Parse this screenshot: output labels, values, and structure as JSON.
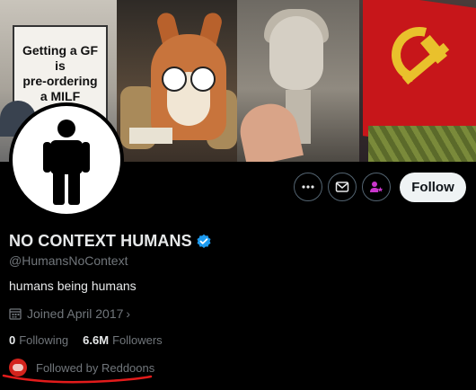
{
  "banner": {
    "sign_lines": [
      "Getting a GF",
      "is",
      "pre-ordering",
      "a MILF"
    ]
  },
  "profile": {
    "display_name": "NO CONTEXT HUMANS",
    "handle": "@HumansNoContext",
    "bio": "humans being humans",
    "joined": "Joined April 2017",
    "following_count": "0",
    "following_label": "Following",
    "followers_count": "6.6M",
    "followers_label": "Followers",
    "followed_by": "Followed by Reddoons"
  },
  "actions": {
    "follow_label": "Follow"
  },
  "colors": {
    "verified_blue": "#1d9bf0",
    "subscribe_purple": "#c936cc",
    "annotation_red": "#e21b1b"
  },
  "icons": [
    "more-icon",
    "message-icon",
    "subscribe-icon",
    "calendar-icon",
    "verified-icon"
  ]
}
